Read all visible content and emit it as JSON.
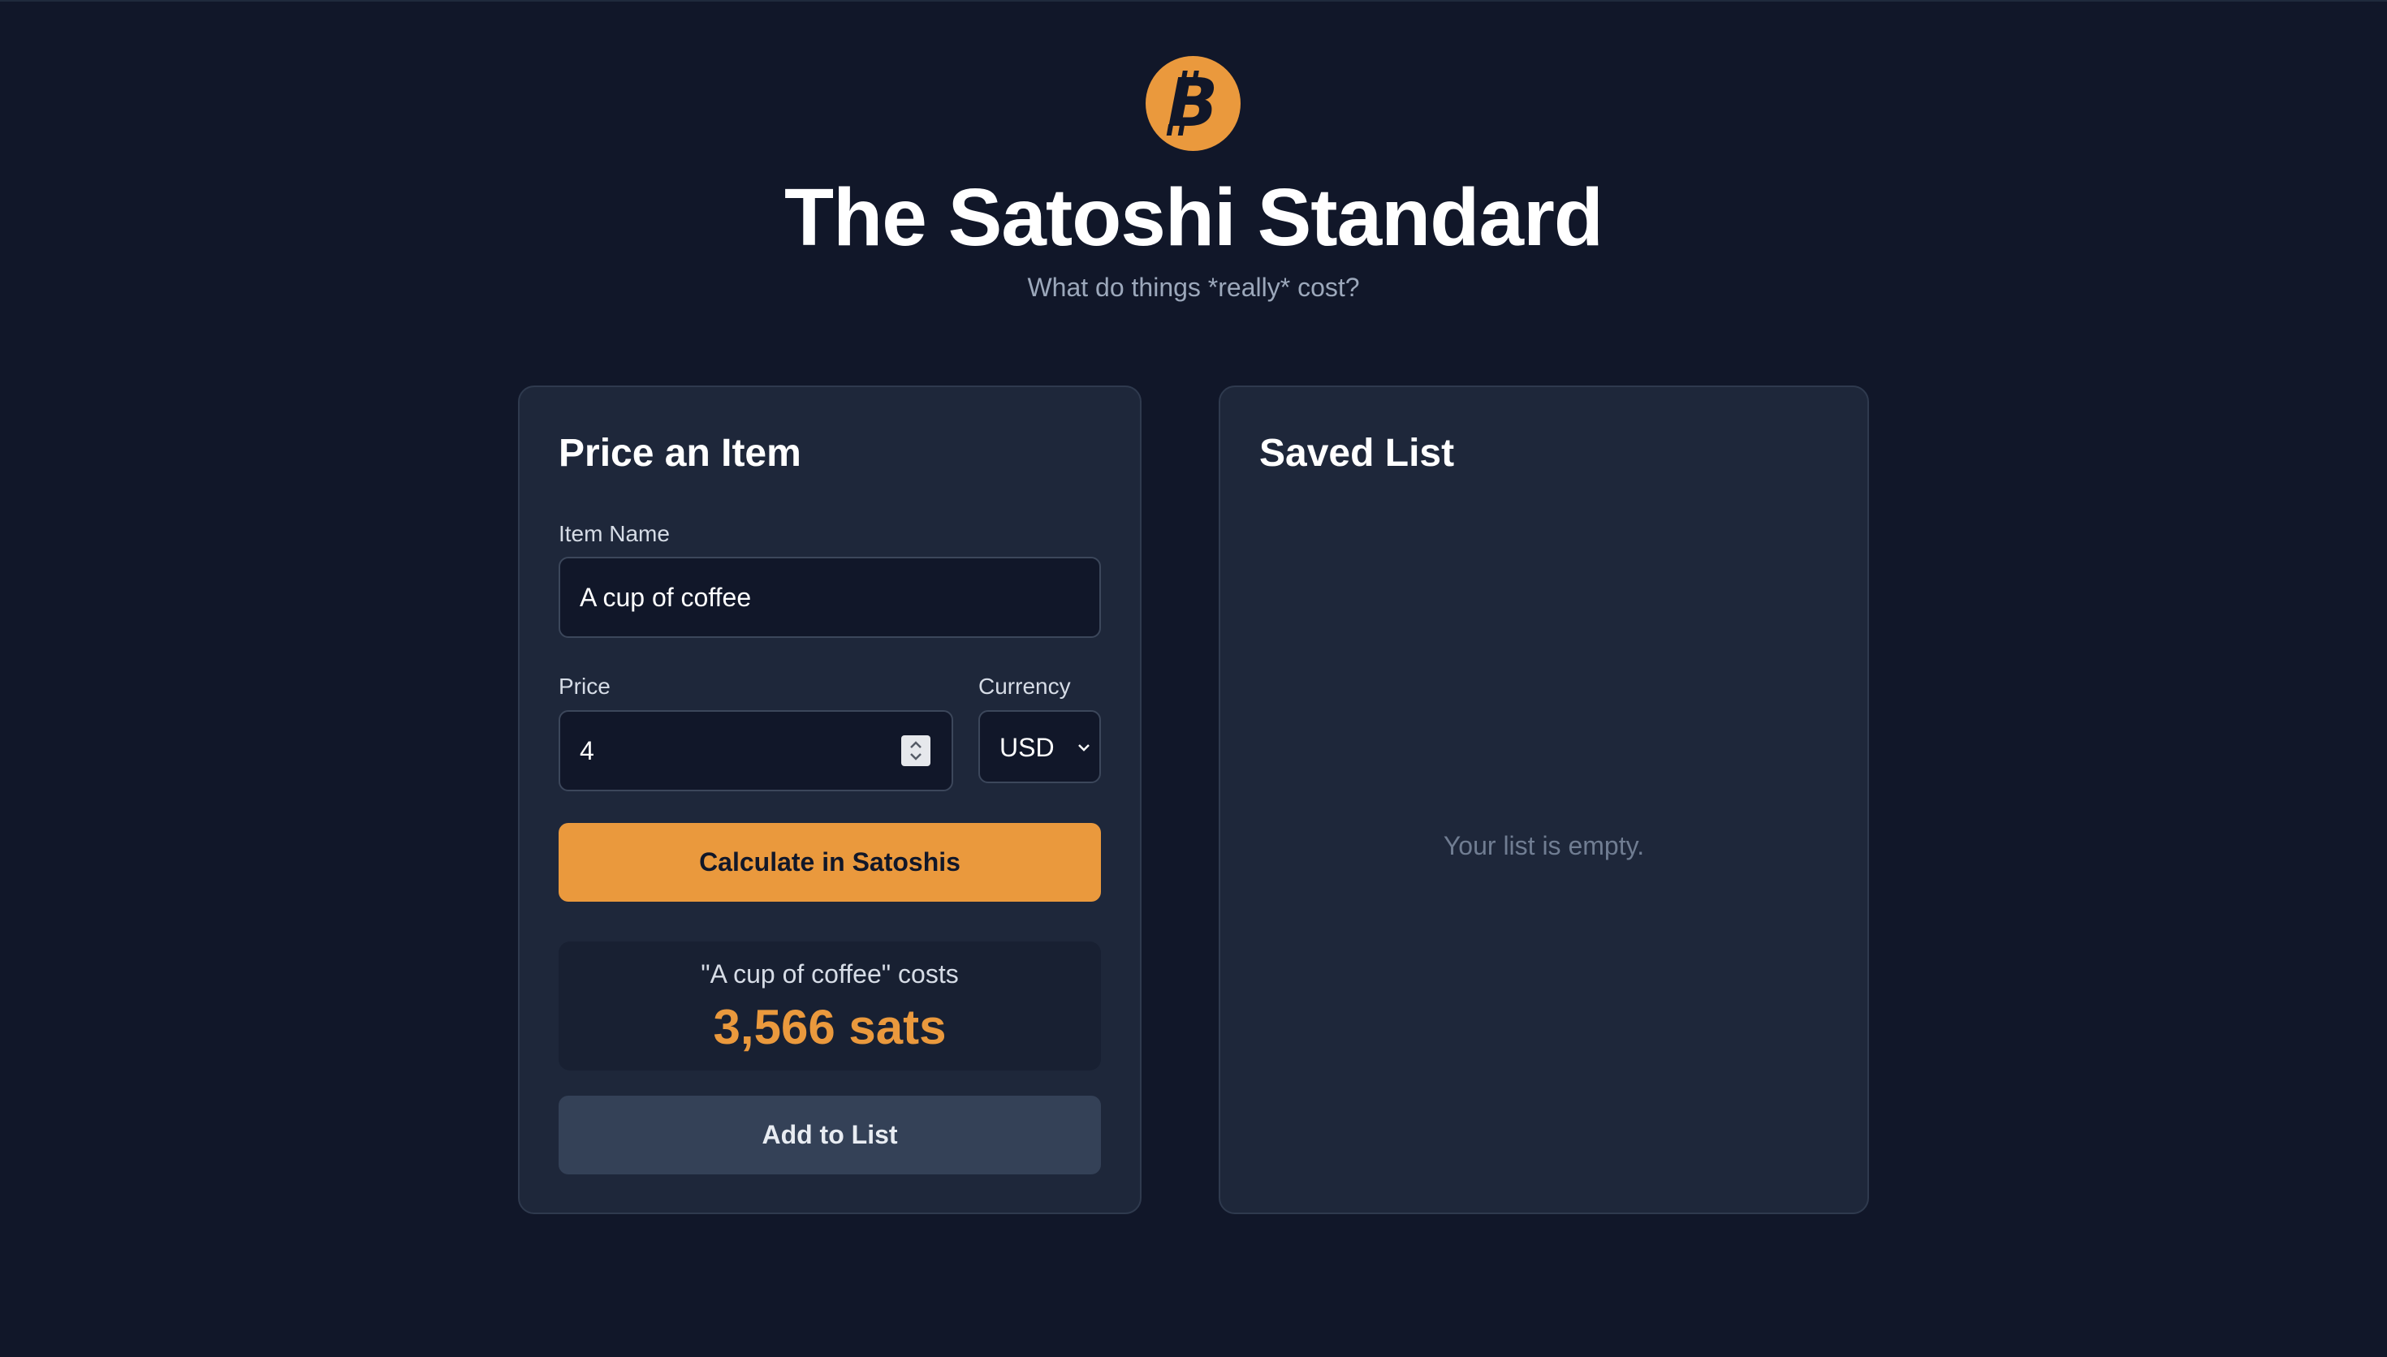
{
  "header": {
    "logo_icon": "bitcoin-icon",
    "title": "The Satoshi Standard",
    "subtitle": "What do things *really* cost?"
  },
  "price_card": {
    "title": "Price an Item",
    "item_name_label": "Item Name",
    "item_name_value": "A cup of coffee",
    "price_label": "Price",
    "price_value": "4",
    "currency_label": "Currency",
    "currency_selected": "USD",
    "calculate_button": "Calculate in Satoshis",
    "result_caption": "\"A cup of coffee\" costs",
    "result_value": "3,566 sats",
    "add_button": "Add to List"
  },
  "saved_list": {
    "title": "Saved List",
    "empty_message": "Your list is empty."
  },
  "colors": {
    "background": "#111729",
    "card": "#1e273a",
    "accent": "#ea993d",
    "secondary_button": "#344157",
    "muted_text": "#9ca8bb"
  }
}
